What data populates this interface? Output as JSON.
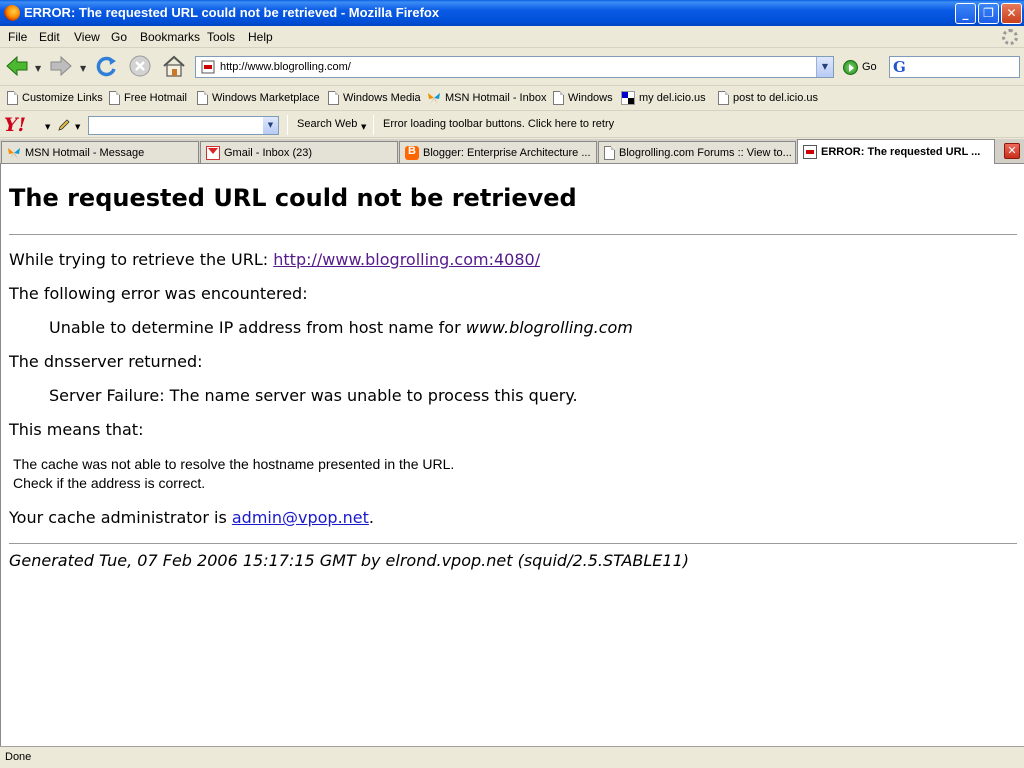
{
  "window": {
    "title": "ERROR: The requested URL could not be retrieved - Mozilla Firefox",
    "minimize_label": "_",
    "maximize_label": "❐",
    "close_label": "✕"
  },
  "menu": {
    "items": [
      "File",
      "Edit",
      "View",
      "Go",
      "Bookmarks",
      "Tools",
      "Help"
    ]
  },
  "navigation": {
    "url": "http://www.blogrolling.com/",
    "go_label": "Go",
    "search_value": "",
    "search_engine_glyph": "G"
  },
  "bookmarks": {
    "items": [
      "Customize Links",
      "Free Hotmail",
      "Windows Marketplace",
      "Windows Media",
      "MSN Hotmail - Inbox",
      "Windows",
      "my del.icio.us",
      "post to del.icio.us"
    ]
  },
  "yahoo_toolbar": {
    "logo": "Y!",
    "search_value": "",
    "search_web_label": "Search Web",
    "error_message": "Error loading toolbar buttons. Click here to retry"
  },
  "tabs": [
    {
      "label": "MSN Hotmail - Message",
      "icon": "msn-butterfly-icon"
    },
    {
      "label": "Gmail - Inbox (23)",
      "icon": "gmail-icon"
    },
    {
      "label": "Blogger: Enterprise Architecture ...",
      "icon": "blogger-icon"
    },
    {
      "label": "Blogrolling.com Forums :: View to...",
      "icon": "page-icon"
    },
    {
      "label": "ERROR: The requested URL ...",
      "icon": "error-page-icon",
      "active": true
    }
  ],
  "content": {
    "heading": "The requested URL could not be retrieved",
    "retrieve_prefix": "While trying to retrieve the URL: ",
    "retrieve_url": "http://www.blogrolling.com:4080/",
    "error_intro": "The following error was encountered:",
    "error_detail_prefix": "Unable to determine IP address from host name for ",
    "error_detail_host": "www.blogrolling.com",
    "dns_intro": "The dnsserver returned:",
    "dns_detail": "Server Failure: The name server was unable to process this query.",
    "means_intro": "This means that:",
    "means_line1": "The cache was not able to resolve the hostname presented in the URL.",
    "means_line2": "Check if the address is correct.",
    "admin_prefix": "Your cache administrator is ",
    "admin_email": "admin@vpop.net",
    "admin_suffix": ".",
    "generated": "Generated Tue, 07 Feb 2006 15:17:15 GMT by elrond.vpop.net (squid/2.5.STABLE11)"
  },
  "status": {
    "text": "Done"
  },
  "colors": {
    "titlebar": "#0054e3",
    "visited_link": "#551a8b",
    "link": "#1a1acc",
    "chrome": "#ece9d8"
  }
}
